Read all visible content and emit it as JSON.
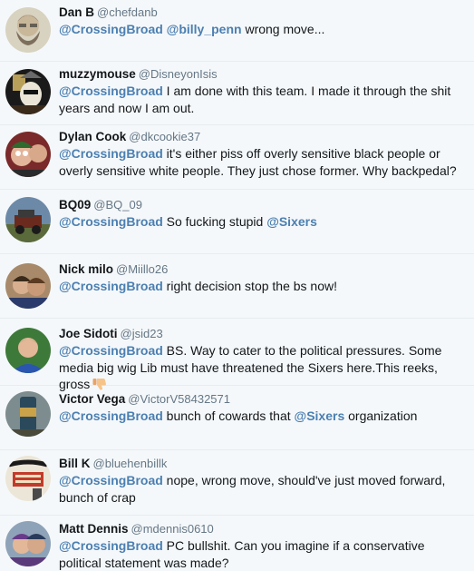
{
  "replies": [
    {
      "name": "Dan B",
      "handle": "@chefdanb",
      "mention1": "@CrossingBroad",
      "mention2": "@billy_penn",
      "text": " wrong move...",
      "avatar_icon": "bearded-man-sketch-avatar"
    },
    {
      "name": "muzzymouse",
      "handle": "@DisneyonIsis",
      "mention1": "@CrossingBroad",
      "text": " I am done with this team. I made it through the shit years and now I am out.",
      "avatar_icon": "masked-figure-avatar"
    },
    {
      "name": "Dylan Cook",
      "handle": "@dkcookie37",
      "mention1": "@CrossingBroad",
      "text": " it's either piss off overly sensitive black people or overly sensitive white people. They just chose former. Why backpedal?",
      "avatar_icon": "group-selfie-avatar"
    },
    {
      "name": "BQ09",
      "handle": "@BQ_09",
      "mention1": "@CrossingBroad",
      "text": " So fucking stupid ",
      "mention2": "@Sixers",
      "avatar_icon": "jeep-avatar"
    },
    {
      "name": "Nick milo",
      "handle": "@Miillo26",
      "mention1": "@CrossingBroad",
      "text": " right decision stop the bs now!",
      "avatar_icon": "couple-photo-avatar"
    },
    {
      "name": "Joe Sidoti",
      "handle": "@jsid23",
      "mention1": "@CrossingBroad",
      "text": " BS. Way to cater to the political pressures. Some media big wig Lib must have threatened the Sixers here.This reeks, gross",
      "emoji": "thumbs-down-icon",
      "avatar_icon": "man-blue-shirt-avatar"
    },
    {
      "name": "Victor Vega",
      "handle": "@VictorV58432571",
      "mention1": "@CrossingBroad",
      "text": " bunch of cowards that ",
      "mention2": "@Sixers",
      "text2": " organization",
      "avatar_icon": "beer-can-avatar"
    },
    {
      "name": "Bill K",
      "handle": "@bluehenbillk",
      "mention1": "@CrossingBroad",
      "text": " nope, wrong move, should've just moved forward, bunch of crap",
      "avatar_icon": "yuengling-sign-avatar"
    },
    {
      "name": "Matt Dennis",
      "handle": "@mdennis0610",
      "mention1": "@CrossingBroad",
      "text": " PC bullshit. Can you imagine if a conservative political statement was made?",
      "avatar_icon": "couple-hats-avatar"
    }
  ],
  "colors": {
    "background": "#f5f8fa",
    "mention": "#4b7fb1",
    "name": "#14171a",
    "handle": "#657786",
    "divider": "#e6ecf0"
  }
}
